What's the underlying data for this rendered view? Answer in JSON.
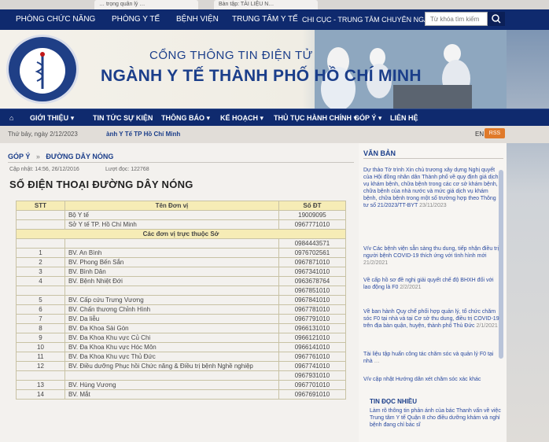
{
  "browser": {
    "tabs": [
      "… trọng quân lý …",
      "Bàn tập: TÀI LIỆU N…"
    ]
  },
  "topnav": {
    "items": [
      "PHÒNG CHỨC NĂNG",
      "PHÒNG Y TẾ",
      "BỆNH VIỆN",
      "TRUNG TÂM Y TẾ",
      "CHI CỤC - TRUNG TÂM CHUYÊN NGÀNH"
    ],
    "search_placeholder": "Từ khóa tìm kiếm"
  },
  "banner": {
    "line1": "CỔNG THÔNG TIN ĐIỆN TỬ",
    "line2": "NGÀNH Y TẾ THÀNH PHỐ HỒ CHÍ MINH",
    "logo_text": "SỞ Y TẾ TP.HỒ CHÍ MINH"
  },
  "mainnav": {
    "items": [
      "GIỚI THIỆU",
      "TIN TỨC SỰ KIỆN",
      "THÔNG BÁO",
      "KẾ HOẠCH",
      "THỦ TỤC HÀNH CHÍNH",
      "GÓP Ý",
      "LIÊN HỆ"
    ]
  },
  "infobar": {
    "date": "Thứ bảy, ngày 2/12/2023",
    "ticker": "ành Y Tế TP Hồ Chí Minh",
    "lang": "EN",
    "rss": "RSS"
  },
  "content": {
    "breadcrumb": [
      "GÓP Ý",
      "ĐƯỜNG DÂY NÓNG"
    ],
    "updated": "Cập nhật: 14:56, 26/12/2016",
    "views": "Lượt đọc: 122768",
    "title": "SỐ ĐIỆN THOẠI ĐƯỜNG DÂY NÓNG",
    "table": {
      "headers": [
        "STT",
        "Tên Đơn vị",
        "Số ĐT"
      ],
      "top_rows": [
        {
          "name": "Bộ Y tế",
          "phone": "19009095"
        },
        {
          "name": "Sở Y tế TP. Hồ Chí Minh",
          "phone": "0967771010"
        }
      ],
      "section": "Các đơn vị trực thuộc Sở",
      "rows": [
        {
          "stt": "",
          "name": "",
          "phone": "0984443571"
        },
        {
          "stt": "1",
          "name": "BV. An Bình",
          "phone": "0976702561"
        },
        {
          "stt": "2",
          "name": "BV. Phong Bến Sắn",
          "phone": "0967871010"
        },
        {
          "stt": "3",
          "name": "BV. Bình Dân",
          "phone": "0967341010"
        },
        {
          "stt": "4",
          "name": "BV. Bệnh Nhiệt Đới",
          "phone": "0963678764"
        },
        {
          "stt": "",
          "name": "",
          "phone": "0967851010"
        },
        {
          "stt": "5",
          "name": "BV. Cấp cứu Trưng Vương",
          "phone": "0967841010"
        },
        {
          "stt": "6",
          "name": "BV. Chấn thương Chỉnh Hình",
          "phone": "0967781010"
        },
        {
          "stt": "7",
          "name": "BV. Da liễu",
          "phone": "0967791010"
        },
        {
          "stt": "8",
          "name": "BV. Đa Khoa Sài Gòn",
          "phone": "0966131010"
        },
        {
          "stt": "9",
          "name": "BV. Đa Khoa Khu vực Củ Chi",
          "phone": "0966121010"
        },
        {
          "stt": "10",
          "name": "BV. Đa Khoa Khu vực Hóc Môn",
          "phone": "0966141010"
        },
        {
          "stt": "11",
          "name": "BV. Đa Khoa Khu vực Thủ Đức",
          "phone": "0967761010"
        },
        {
          "stt": "12",
          "name": "BV. Điều dưỡng Phục hồi Chức năng & Điều trị bệnh Nghề nghiệp",
          "phone": "0967741010"
        },
        {
          "stt": "",
          "name": "",
          "phone": "0967931010"
        },
        {
          "stt": "13",
          "name": "BV. Hùng Vương",
          "phone": "0967701010"
        },
        {
          "stt": "14",
          "name": "BV. Mắt",
          "phone": "0967691010"
        }
      ]
    }
  },
  "sidebar": {
    "heading": "VĂN BẢN",
    "items": [
      {
        "text": "Dự thảo Tờ trình Xin chủ trương xây dựng Nghị quyết của Hội đồng nhân dân Thành phố về quy định giá dịch vụ khám bệnh, chữa bệnh trong các cơ sở khám bệnh, chữa bệnh của nhà nước và mức giá dịch vụ khám bệnh, chữa bệnh trong một số trường hợp theo Thông tư số 21/2023/TT-BYT",
        "date": "23/11/2023"
      },
      {
        "text": "V/v Các bệnh viện sẵn sàng thu dung, tiếp nhận điều trị người bệnh COVID-19 thích ứng với tình hình mới",
        "date": "21/2/2021"
      },
      {
        "text": "Về cấp hồ sơ đề nghị giải quyết chế độ BHXH đối với lao động là F0",
        "date": "2/2/2021"
      },
      {
        "text": "Về ban hành Quy chế phối hợp quản lý, tổ chức chăm sóc F0 tại nhà và tại Cơ sở thu dung, điều trị COVID-19 trên địa bàn quận, huyện, thành phố Thủ Đức",
        "date": "2/1/2021"
      },
      {
        "text": "Tài liệu tập huấn công tác chăm sóc và quản lý F0 tại nhà",
        "date": "…"
      },
      {
        "text": "V/v cập nhật Hướng dẫn xét chăm sóc xác khác",
        "date": ""
      }
    ],
    "tin_heading": "TIN ĐỌC NHIỀU",
    "tin_text": "Làm rõ thông tin phản ánh của bác Thanh vấn về việc Trung tâm Y tế Quận 8 cho điều dưỡng khám và nghỉ bệnh đang chỉ bác sĩ"
  }
}
